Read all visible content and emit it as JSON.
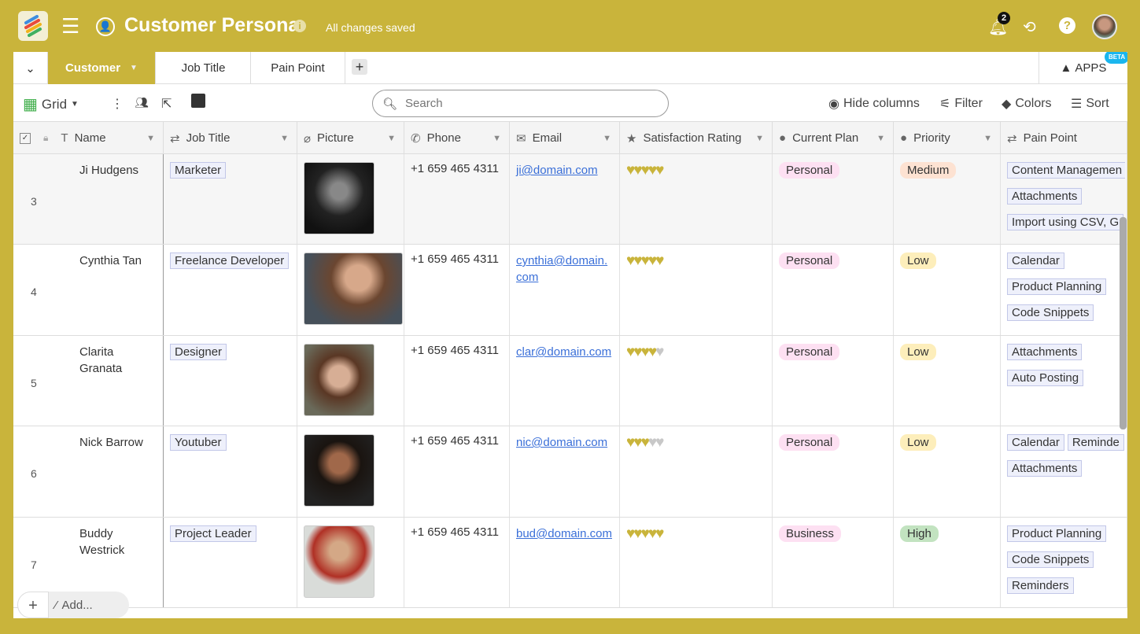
{
  "app": {
    "title": "Customer Persona",
    "status": "All changes saved",
    "notification_count": "2",
    "accent": "#c9b43b"
  },
  "tabs": [
    {
      "label": "Customer",
      "active": true
    },
    {
      "label": "Job Title"
    },
    {
      "label": "Pain Point"
    }
  ],
  "apps": {
    "label": "APPS",
    "badge": "BETA"
  },
  "toolbar": {
    "view": "Grid",
    "search_placeholder": "Search",
    "hide_columns": "Hide columns",
    "filter": "Filter",
    "colors": "Colors",
    "sort": "Sort"
  },
  "columns": [
    "Name",
    "Job Title",
    "Picture",
    "Phone",
    "Email",
    "Satisfaction Rating",
    "Current Plan",
    "Priority",
    "Pain Point"
  ],
  "rows": [
    {
      "num": "3",
      "name": "Ji Hudgens",
      "job": "Marketer",
      "phone": "+1 659 465 4311",
      "email": "ji@domain.com",
      "rating": 5,
      "plan": "Personal",
      "priority": "Medium",
      "pains": [
        "Content Managemen",
        "Attachments",
        "Import using CSV, G"
      ]
    },
    {
      "num": "4",
      "name": "Cynthia Tan",
      "job": "Freelance Developer",
      "phone": "+1 659 465 4311",
      "email": "cynthia@domain.com",
      "rating": 5,
      "plan": "Personal",
      "priority": "Low",
      "pains": [
        "Calendar",
        "Product Planning",
        "Code Snippets"
      ]
    },
    {
      "num": "5",
      "name": "Clarita Granata",
      "job": "Designer",
      "phone": "+1 659 465 4311",
      "email": "clar@domain.com",
      "rating": 4,
      "plan": "Personal",
      "priority": "Low",
      "pains": [
        "Attachments",
        "Auto Posting"
      ]
    },
    {
      "num": "6",
      "name": "Nick Barrow",
      "job": "Youtuber",
      "phone": "+1 659 465 4311",
      "email": "nic@domain.com",
      "rating": 3,
      "plan": "Personal",
      "priority": "Low",
      "pains": [
        "Calendar",
        "Reminde",
        "Attachments"
      ]
    },
    {
      "num": "7",
      "name": "Buddy Westrick",
      "job": "Project Leader",
      "phone": "+1 659 465 4311",
      "email": "bud@domain.com",
      "rating": 5,
      "plan": "Business",
      "priority": "High",
      "pains": [
        "Product Planning",
        "Code Snippets",
        "Reminders"
      ]
    }
  ],
  "rating_max": 5,
  "colors": {
    "Personal": "#fde0f2",
    "Business": "#fde0f2",
    "Medium": "#fde2d2",
    "Low": "#fdeebb",
    "High": "#c2e3c0",
    "heart_on": "#c9b43b",
    "heart_off": "#c8c8c8"
  },
  "add_label": "Add..."
}
